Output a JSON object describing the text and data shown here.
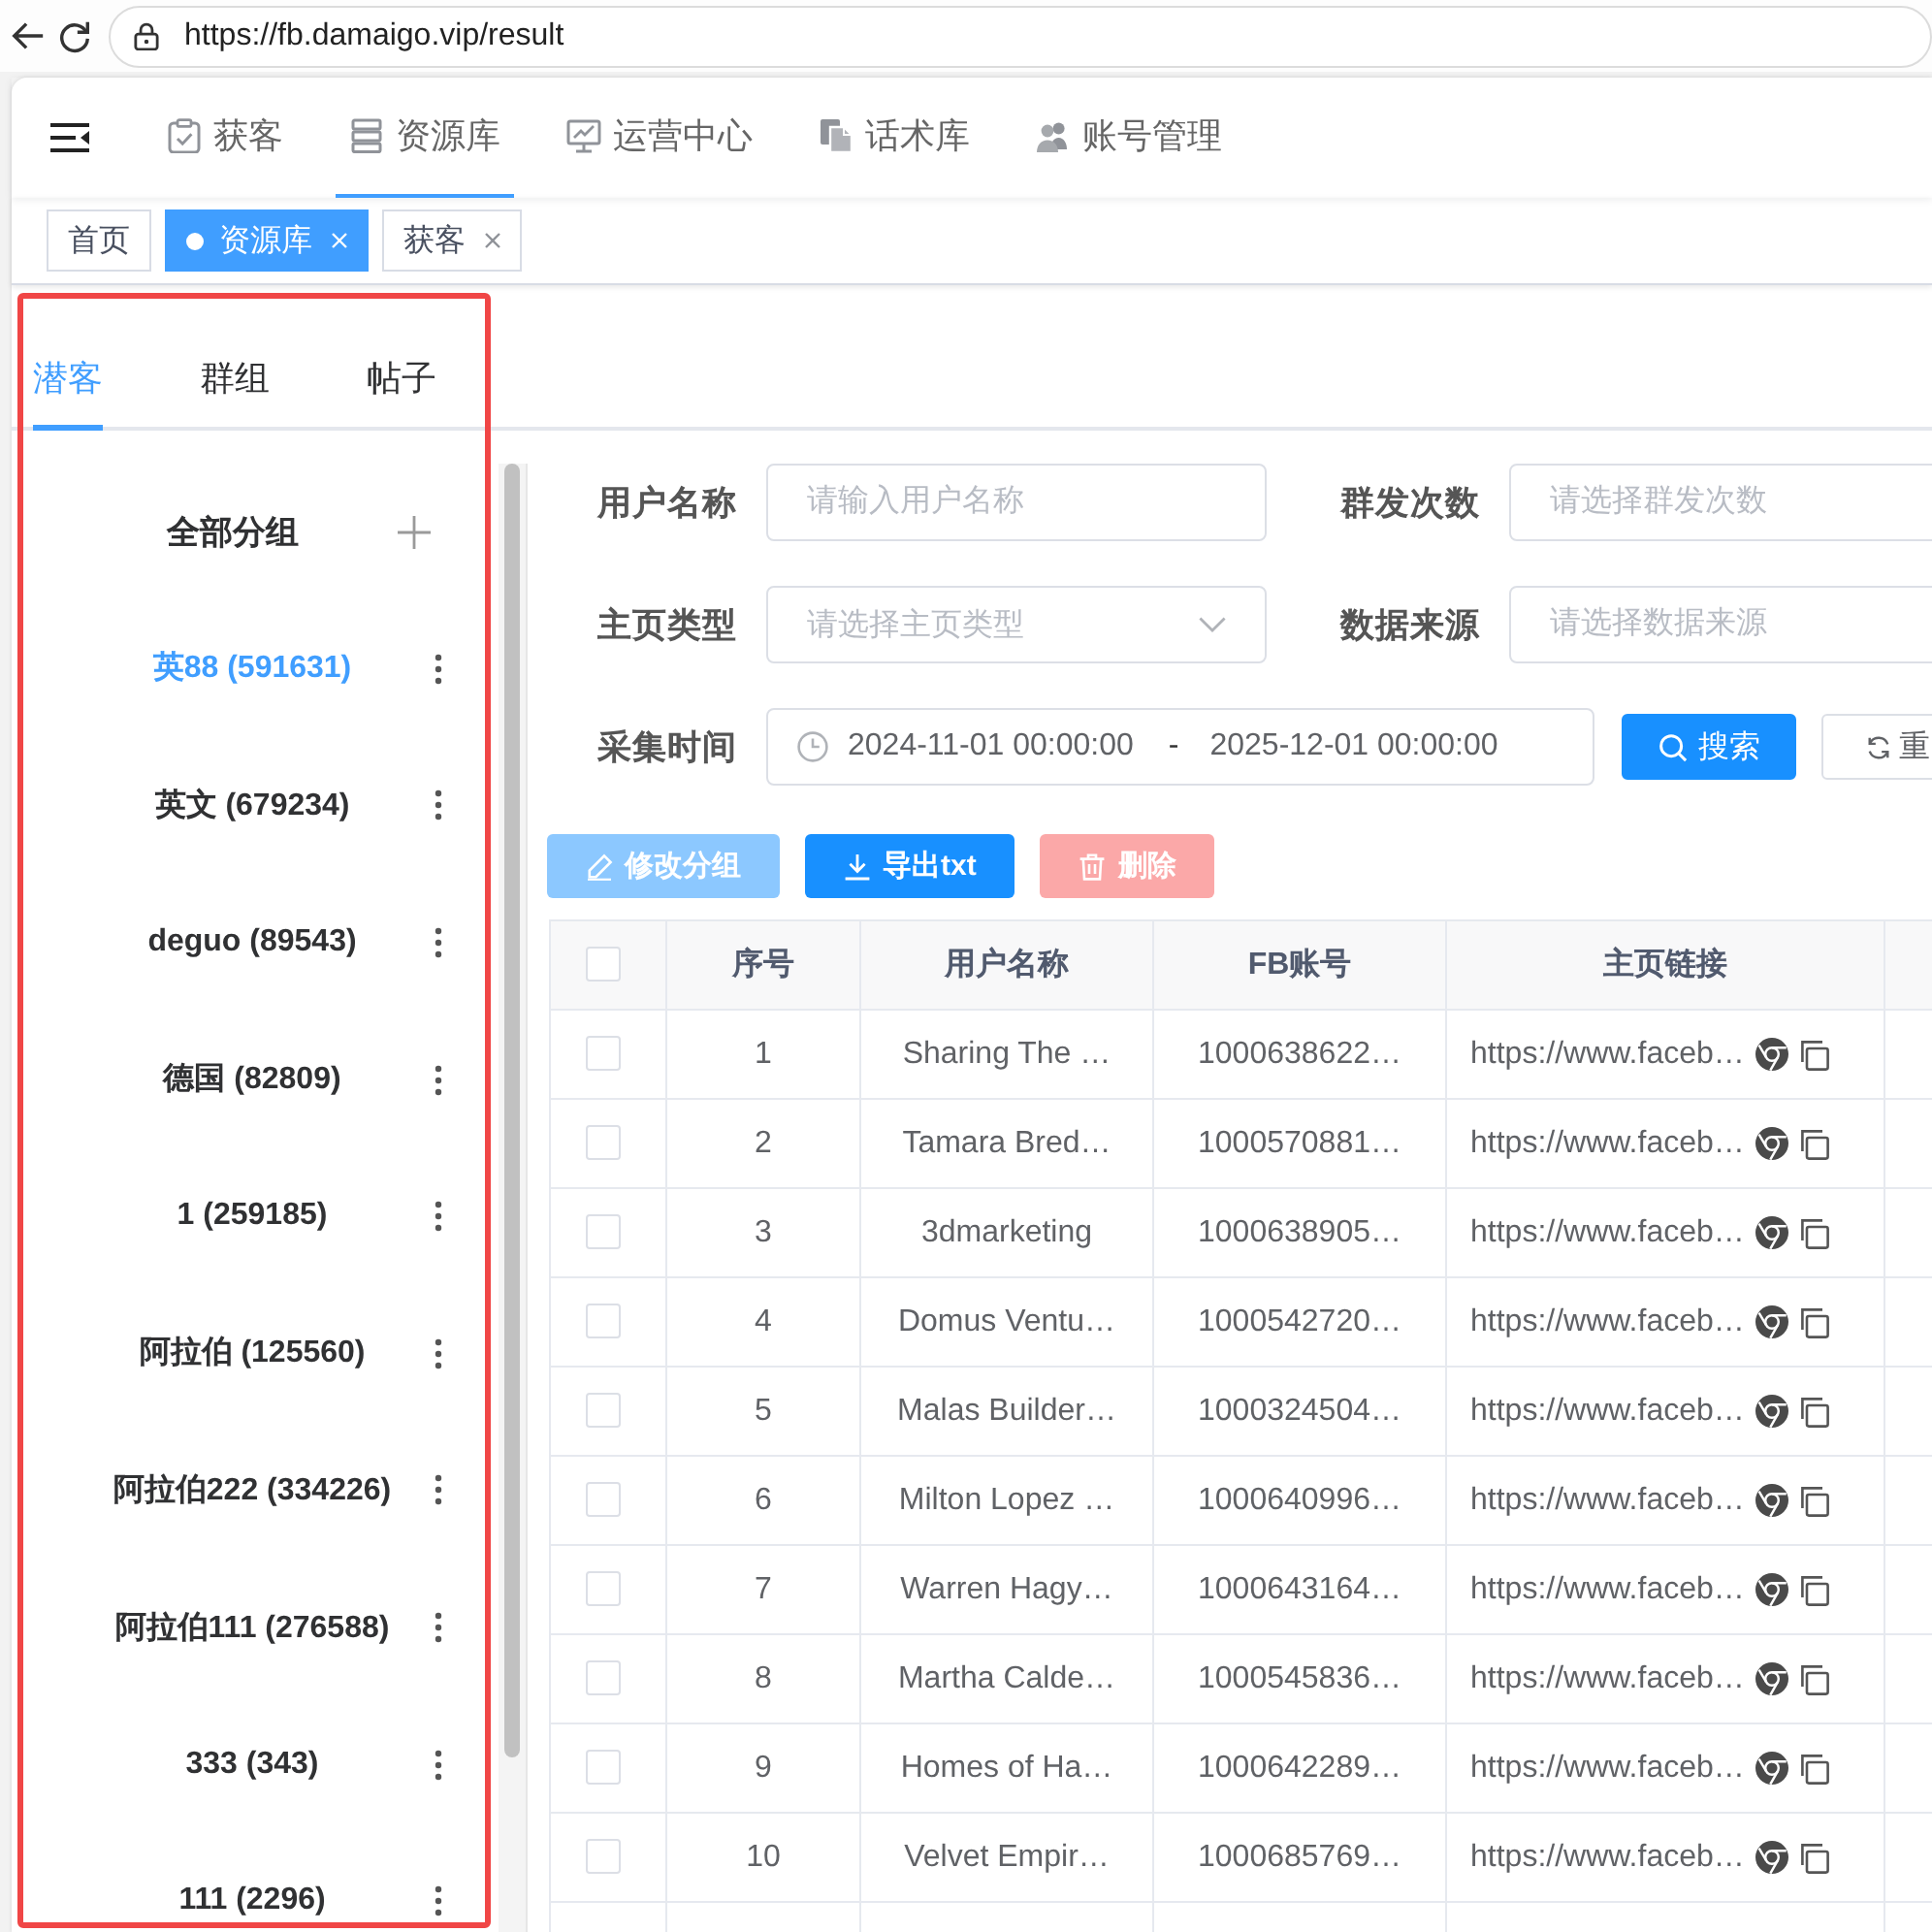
{
  "browser": {
    "url": "https://fb.damaigo.vip/result"
  },
  "top_nav": {
    "items": [
      {
        "label": "获客",
        "selected": false
      },
      {
        "label": "资源库",
        "selected": true
      },
      {
        "label": "运营中心",
        "selected": false
      },
      {
        "label": "话术库",
        "selected": false
      },
      {
        "label": "账号管理",
        "selected": false
      }
    ]
  },
  "tags": [
    {
      "label": "首页",
      "selected": false,
      "closable": false
    },
    {
      "label": "资源库",
      "selected": true,
      "closable": true
    },
    {
      "label": "获客",
      "selected": false,
      "closable": true
    }
  ],
  "tabs": [
    {
      "label": "潜客",
      "selected": true
    },
    {
      "label": "群组",
      "selected": false
    },
    {
      "label": "帖子",
      "selected": false
    }
  ],
  "groups": {
    "title": "全部分组",
    "items": [
      {
        "label": "英88 (591631)",
        "selected": true
      },
      {
        "label": "英文 (679234)",
        "selected": false
      },
      {
        "label": "deguo (89543)",
        "selected": false
      },
      {
        "label": "德国 (82809)",
        "selected": false
      },
      {
        "label": "1 (259185)",
        "selected": false
      },
      {
        "label": "阿拉伯 (125560)",
        "selected": false
      },
      {
        "label": "阿拉伯222 (334226)",
        "selected": false
      },
      {
        "label": "阿拉伯111 (276588)",
        "selected": false
      },
      {
        "label": "333 (343)",
        "selected": false
      },
      {
        "label": "111 (2296)",
        "selected": false
      }
    ]
  },
  "filters": [
    {
      "label": "用户名称",
      "kind": "input",
      "placeholder": "请输入用户名称"
    },
    {
      "label": "群发次数",
      "kind": "input",
      "placeholder": "请选择群发次数"
    },
    {
      "label": "主页类型",
      "kind": "select",
      "placeholder": "请选择主页类型"
    },
    {
      "label": "数据来源",
      "kind": "input",
      "placeholder": "请选择数据来源"
    },
    {
      "label": "采集时间",
      "kind": "daterange",
      "start": "2024-11-01 00:00:00",
      "separator": "-",
      "end": "2025-12-01 00:00:00"
    }
  ],
  "filter_buttons": [
    {
      "label": "搜索",
      "kind": "search"
    },
    {
      "label": "重",
      "kind": "reset"
    }
  ],
  "actions": [
    {
      "label": "修改分组",
      "kind": "edit",
      "disabled": true
    },
    {
      "label": "导出txt",
      "kind": "export",
      "disabled": false
    },
    {
      "label": "删除",
      "kind": "delete",
      "disabled": true
    }
  ],
  "table": {
    "all_checked": false,
    "columns": [
      "序号",
      "用户名称",
      "FB账号",
      "主页链接"
    ],
    "rows": [
      {
        "checked": false,
        "index": "1",
        "name": "Sharing The …",
        "fb_account": "1000638622…",
        "profile_link": "https://www.faceb…"
      },
      {
        "checked": false,
        "index": "2",
        "name": "Tamara Bred…",
        "fb_account": "1000570881…",
        "profile_link": "https://www.faceb…"
      },
      {
        "checked": false,
        "index": "3",
        "name": "3dmarketing",
        "fb_account": "1000638905…",
        "profile_link": "https://www.faceb…"
      },
      {
        "checked": false,
        "index": "4",
        "name": "Domus Ventu…",
        "fb_account": "1000542720…",
        "profile_link": "https://www.faceb…"
      },
      {
        "checked": false,
        "index": "5",
        "name": "Malas Builder…",
        "fb_account": "1000324504…",
        "profile_link": "https://www.faceb…"
      },
      {
        "checked": false,
        "index": "6",
        "name": "Milton Lopez …",
        "fb_account": "1000640996…",
        "profile_link": "https://www.faceb…"
      },
      {
        "checked": false,
        "index": "7",
        "name": "Warren Hagy…",
        "fb_account": "1000643164…",
        "profile_link": "https://www.faceb…"
      },
      {
        "checked": false,
        "index": "8",
        "name": "Martha Calde…",
        "fb_account": "1000545836…",
        "profile_link": "https://www.faceb…"
      },
      {
        "checked": false,
        "index": "9",
        "name": "Homes of Ha…",
        "fb_account": "1000642289…",
        "profile_link": "https://www.faceb…"
      },
      {
        "checked": false,
        "index": "10",
        "name": "Velvet Empir…",
        "fb_account": "1000685769…",
        "profile_link": "https://www.faceb…"
      }
    ]
  }
}
